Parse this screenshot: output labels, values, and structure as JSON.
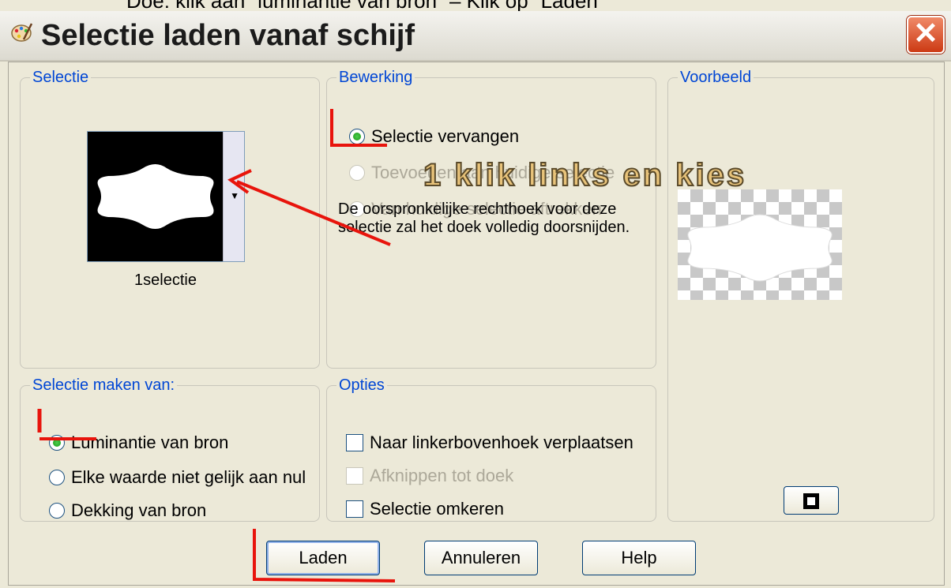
{
  "caption": "Doe: klik aan “luminantie van bron” – Klik op “Laden”",
  "window": {
    "title": "Selectie laden vanaf schijf",
    "close_glyph": "✕"
  },
  "groups": {
    "selectie": {
      "legend": "Selectie",
      "thumbnail_label": "1selectie"
    },
    "bewerking": {
      "legend": "Bewerking",
      "options": [
        {
          "label": "Selectie vervangen",
          "checked": true,
          "enabled": true
        },
        {
          "label": "Toevoegen aan huidige selectie",
          "checked": false,
          "enabled": false
        },
        {
          "label": "Van huidige selectie aftrekken",
          "checked": false,
          "enabled": false
        }
      ],
      "note": "De oorspronkelijke rechthoek voor deze selectie zal het doek volledig doorsnijden."
    },
    "voorbeeld": {
      "legend": "Voorbeeld"
    },
    "selectie_maken_van": {
      "legend": "Selectie maken van:",
      "options": [
        {
          "label": "Luminantie van bron",
          "checked": true
        },
        {
          "label": "Elke waarde niet gelijk aan nul",
          "checked": false
        },
        {
          "label": "Dekking van bron",
          "checked": false
        }
      ]
    },
    "opties": {
      "legend": "Opties",
      "checks": [
        {
          "label": "Naar linkerbovenhoek verplaatsen",
          "checked": false,
          "enabled": true
        },
        {
          "label": "Afknippen tot doek",
          "checked": false,
          "enabled": false
        },
        {
          "label": "Selectie omkeren",
          "checked": false,
          "enabled": true
        }
      ]
    }
  },
  "buttons": {
    "load": "Laden",
    "cancel": "Annuleren",
    "help": "Help"
  },
  "annotation": "1  klik links en kies",
  "colors": {
    "legend": "#0046d5",
    "annotation_red": "#e8140c",
    "dialog_bg": "#ece9d8"
  },
  "icons": {
    "title": "palette-icon",
    "close": "close-icon",
    "preview_toggle": "preview-toggle-icon"
  }
}
